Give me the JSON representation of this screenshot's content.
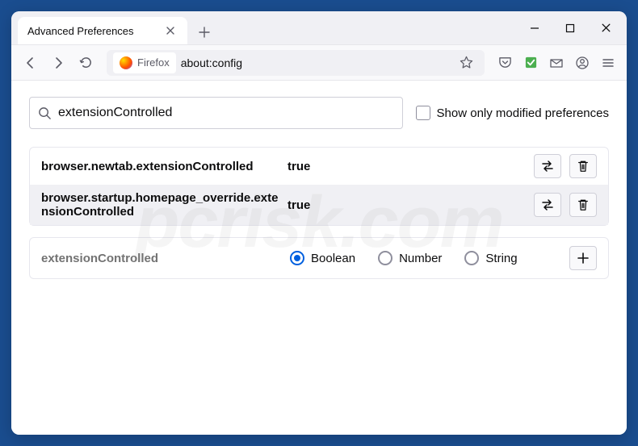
{
  "tab": {
    "title": "Advanced Preferences"
  },
  "identity": {
    "label": "Firefox"
  },
  "url": "about:config",
  "search": {
    "value": "extensionControlled",
    "checkbox_label": "Show only modified preferences"
  },
  "prefs": [
    {
      "name": "browser.newtab.extensionControlled",
      "value": "true"
    },
    {
      "name": "browser.startup.homepage_override.extensionControlled",
      "value": "true"
    }
  ],
  "new_pref": {
    "name": "extensionControlled",
    "types": [
      "Boolean",
      "Number",
      "String"
    ],
    "selected_type": "Boolean"
  },
  "watermark": "pcrisk.com"
}
